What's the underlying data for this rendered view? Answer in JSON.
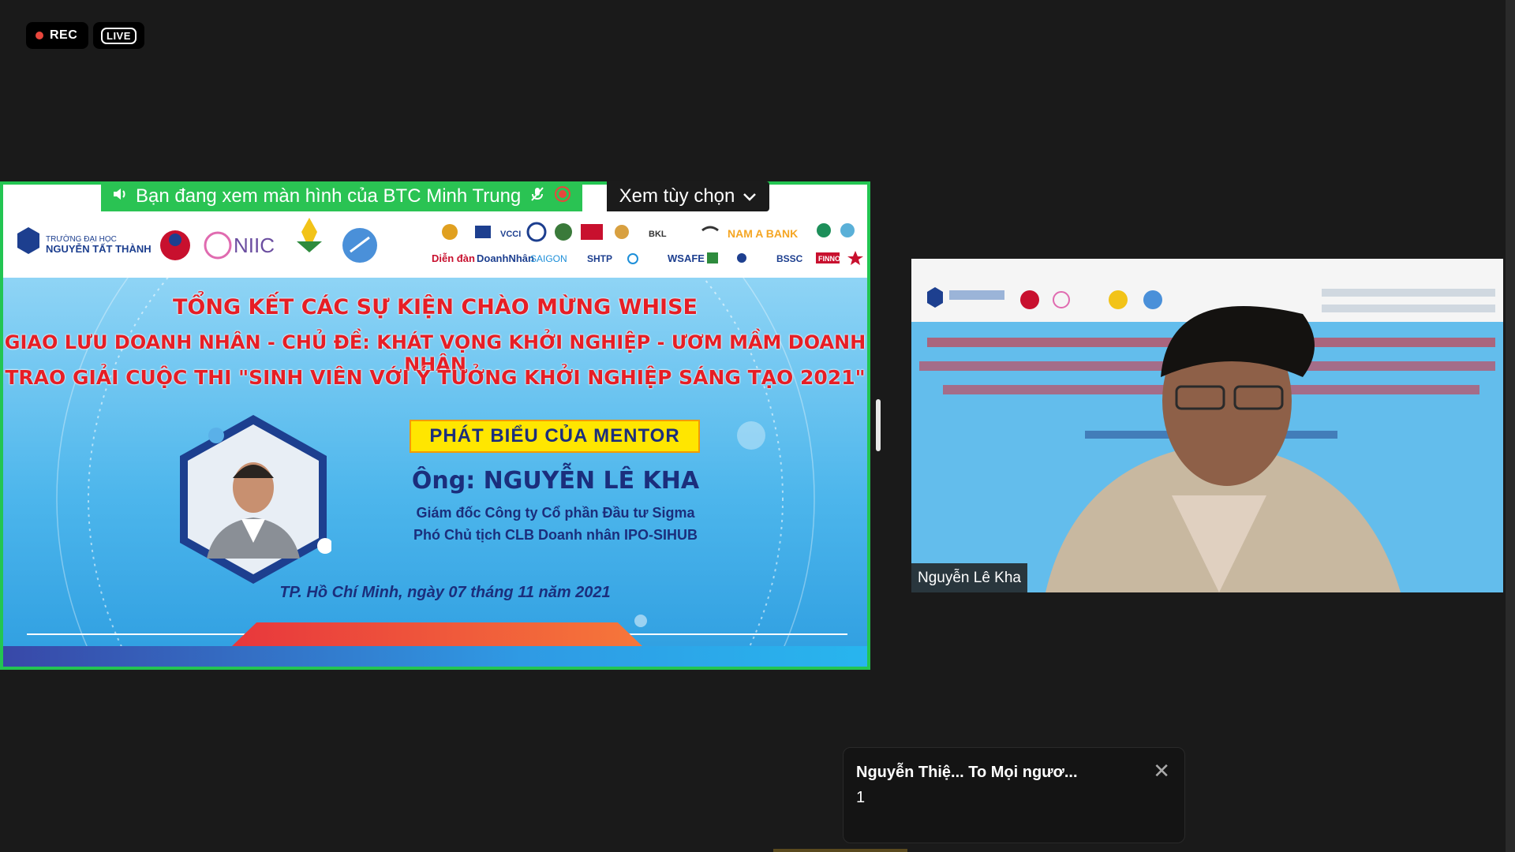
{
  "recording": {
    "rec_label": "REC",
    "live_label": "LIVE"
  },
  "share_banner": {
    "text": "Bạn đang xem màn hình của BTC Minh Trung",
    "view_options_label": "Xem tùy chọn"
  },
  "slide": {
    "title_line1": "TỔNG KẾT CÁC SỰ KIỆN CHÀO MỪNG WHISE",
    "title_line2": "GIAO LƯU DOANH NHÂN - CHỦ ĐỀ: KHÁT VỌNG KHỞI NGHIỆP - ƯƠM MẦM DOANH NHÂN",
    "title_line3": "TRAO GIẢI CUỘC THI \"SINH VIÊN VỚI Ý TƯỞNG KHỞI NGHIỆP SÁNG TẠO 2021\"",
    "mentor_label": "PHÁT BIỂU CỦA MENTOR",
    "mentor_name": "Ông: NGUYỄN LÊ KHA",
    "mentor_role1": "Giám đốc Công ty Cổ phần Đầu tư Sigma",
    "mentor_role2": "Phó Chủ tịch CLB Doanh nhân IPO-SIHUB",
    "date": "TP. Hồ Chí Minh, ngày 07 tháng 11 năm 2021",
    "logos": {
      "school_line1": "TRƯỜNG ĐẠI HỌC",
      "school_line2": "NGUYỄN TẤT THÀNH",
      "niic": "NIIC",
      "khoi_nghiep": "KHỞI NGHIỆP QUỐC GIA",
      "nam_a_bank": "NAM A BANK",
      "dien_dan": "Diễn đàn",
      "doanh_nhan": "DoanhNhân",
      "saigon": "SAIGON",
      "shtp": "SHTP",
      "wsafe": "WSAFE",
      "bss": "BSSC",
      "finno": "FINNO",
      "vcci": "VCCI",
      "bkl": "BKL"
    }
  },
  "participant": {
    "name": "Nguyễn Lê Kha"
  },
  "chat_popup": {
    "sender": "Nguyễn Thiệ... To Mọi ngươ...",
    "message": "1"
  },
  "colors": {
    "accent_green": "#23c552",
    "rec_red": "#e8463c",
    "slide_red": "#e61e25",
    "slide_navy": "#1b2e7c"
  }
}
